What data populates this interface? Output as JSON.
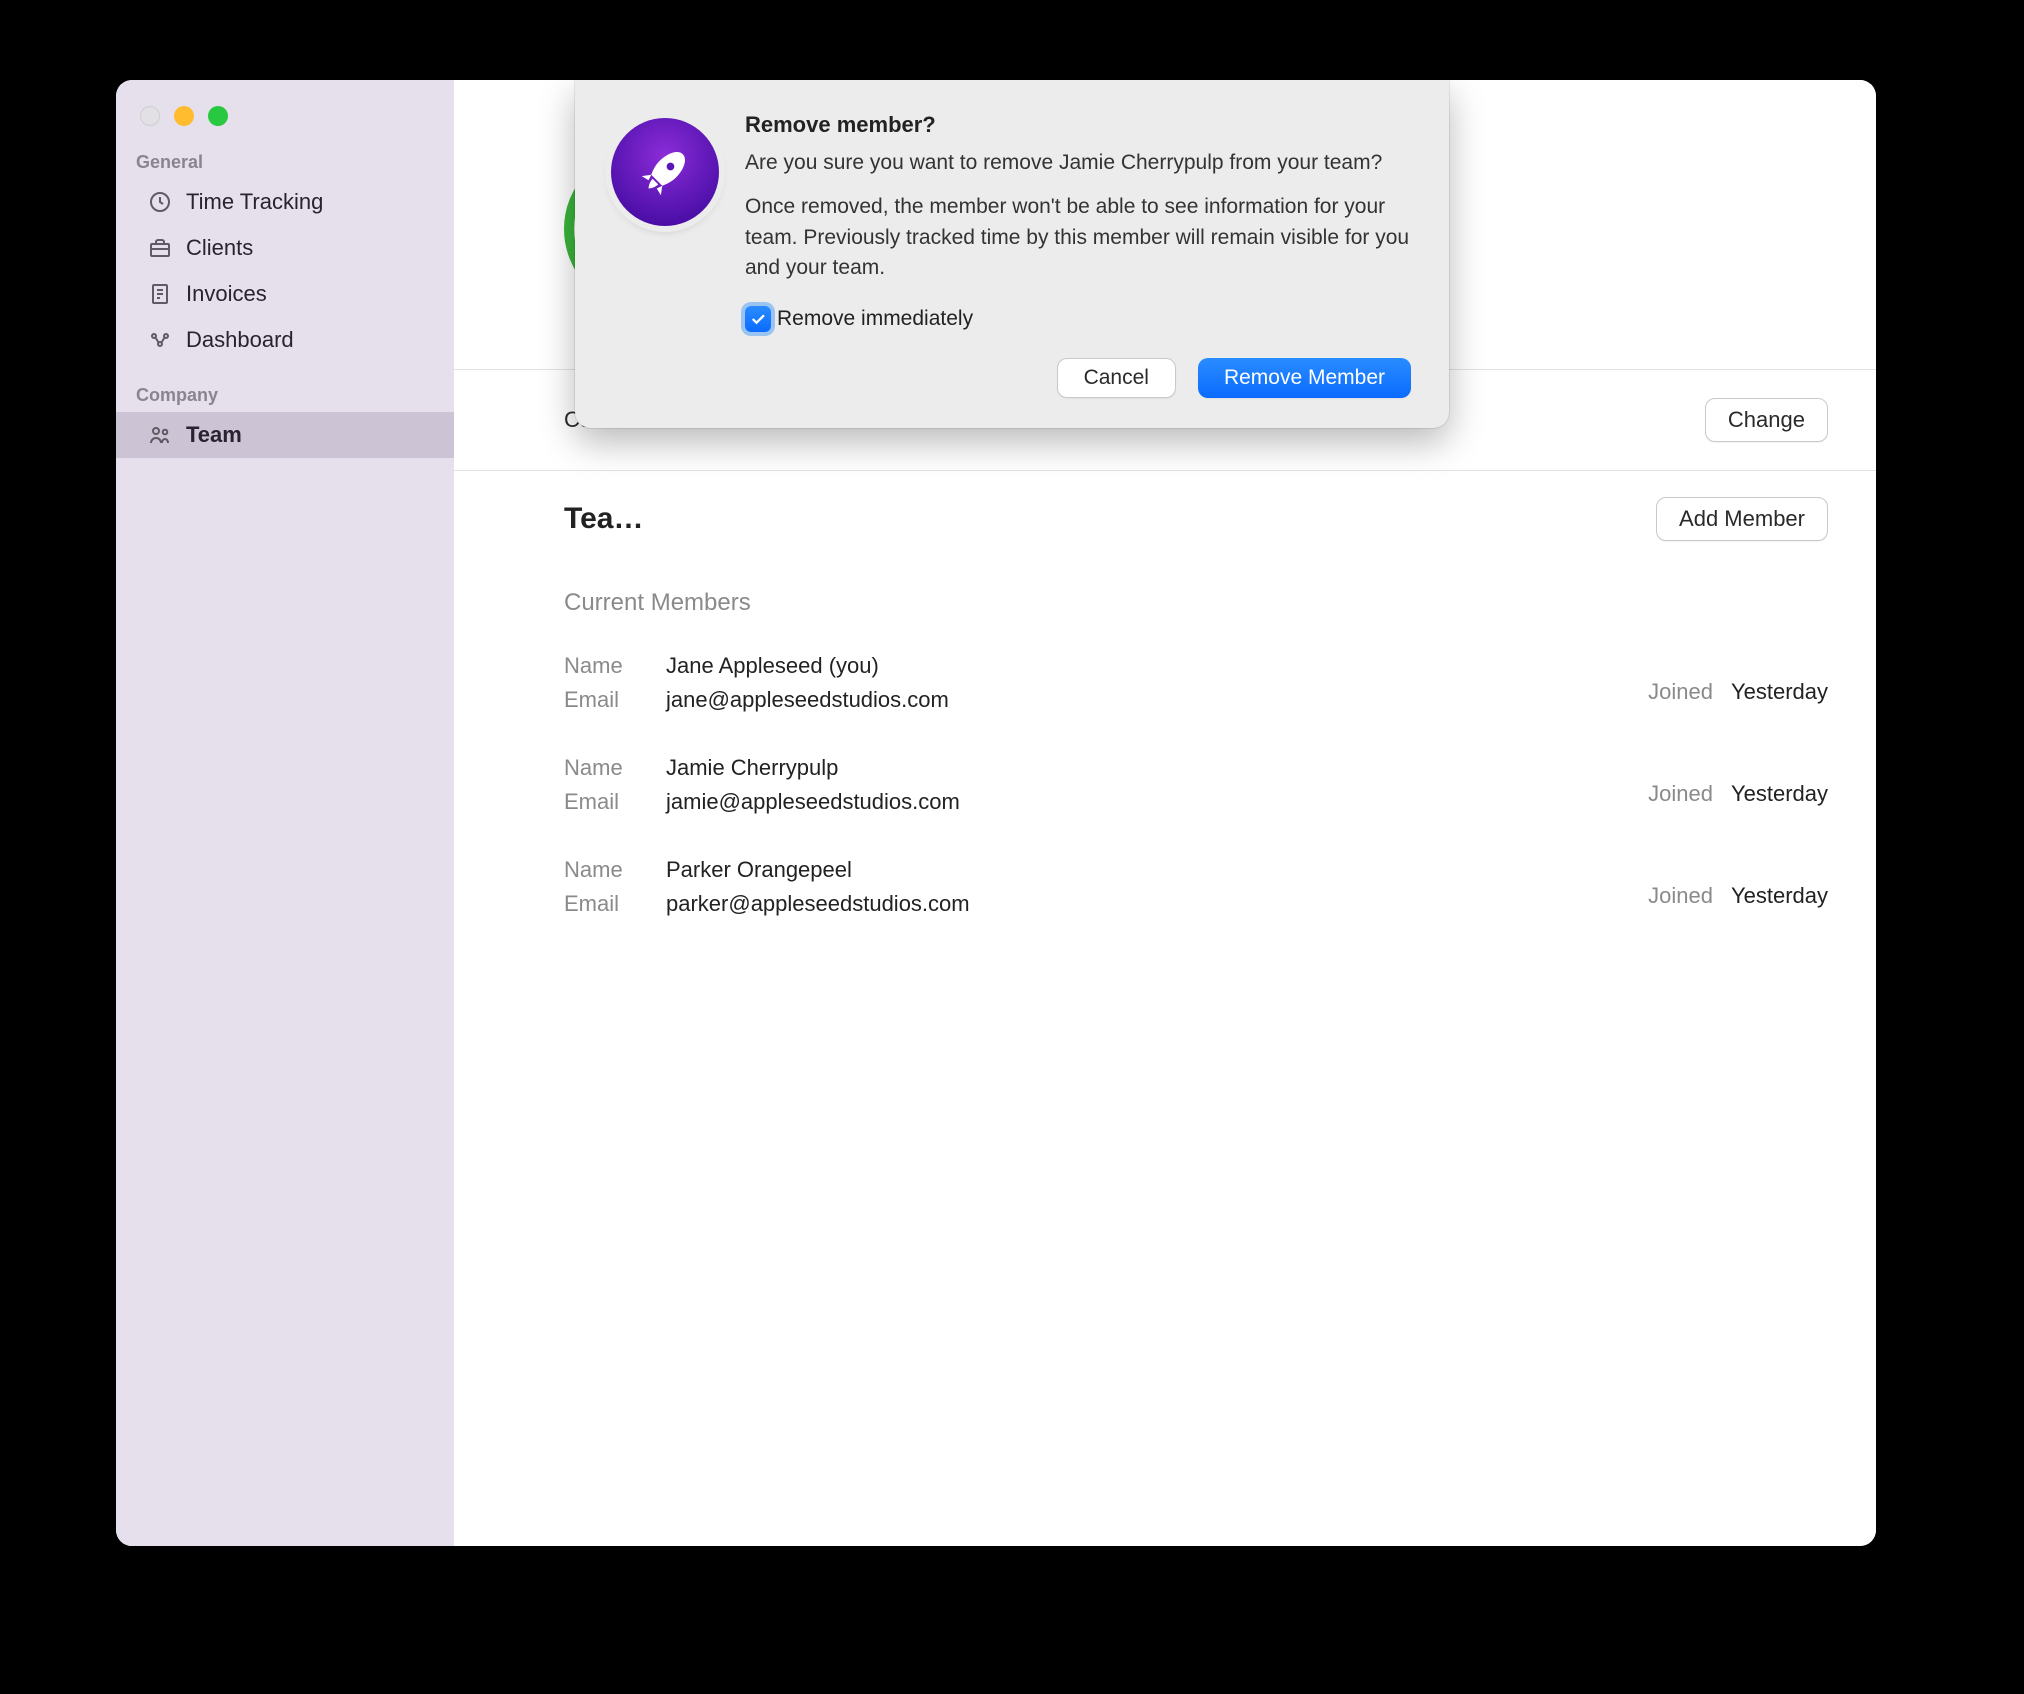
{
  "sidebar": {
    "sections": {
      "general": {
        "label": "General",
        "items": [
          {
            "label": "Time Tracking"
          },
          {
            "label": "Clients"
          },
          {
            "label": "Invoices"
          },
          {
            "label": "Dashboard"
          }
        ]
      },
      "company": {
        "label": "Company",
        "items": [
          {
            "label": "Team"
          }
        ]
      }
    }
  },
  "main": {
    "curr_truncated": "Curr",
    "change_button": "Change",
    "team_title_truncated": "Tea…",
    "add_member_button": "Add Member",
    "current_members_label": "Current Members",
    "field_labels": {
      "name": "Name",
      "email": "Email",
      "joined": "Joined"
    },
    "members": [
      {
        "name": "Jane Appleseed (you)",
        "email": "jane@appleseedstudios.com",
        "joined": "Yesterday"
      },
      {
        "name": "Jamie Cherrypulp",
        "email": "jamie@appleseedstudios.com",
        "joined": "Yesterday"
      },
      {
        "name": "Parker Orangepeel",
        "email": "parker@appleseedstudios.com",
        "joined": "Yesterday"
      }
    ]
  },
  "dialog": {
    "title": "Remove member?",
    "line1": "Are you sure you want to remove Jamie Cherrypulp from your team?",
    "line2": "Once removed, the member won't be able to see information for your team. Previously tracked time by this member will remain visible for you and your team.",
    "checkbox_label": "Remove immediately",
    "checkbox_checked": true,
    "cancel": "Cancel",
    "confirm": "Remove Member"
  }
}
